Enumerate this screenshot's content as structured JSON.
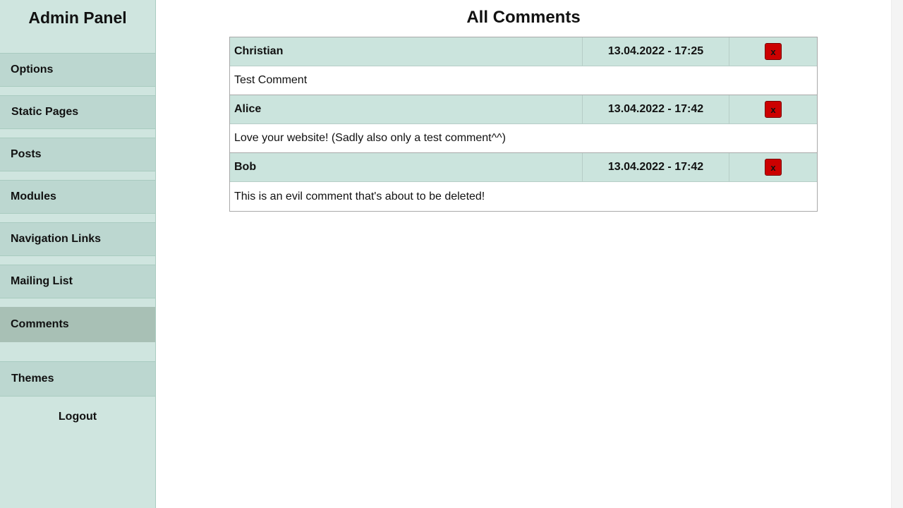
{
  "sidebar": {
    "title": "Admin Panel",
    "items": [
      {
        "label": "Options"
      },
      {
        "label": "Static Pages"
      },
      {
        "label": "Posts"
      },
      {
        "label": "Modules"
      },
      {
        "label": "Navigation Links"
      },
      {
        "label": "Mailing List"
      },
      {
        "label": "Comments",
        "active": true
      },
      {
        "label": "Themes"
      }
    ],
    "logout_label": "Logout"
  },
  "main": {
    "title": "All Comments",
    "comments": [
      {
        "author": "Christian",
        "date": "13.04.2022 - 17:25",
        "text": "Test Comment",
        "delete_label": "x"
      },
      {
        "author": "Alice",
        "date": "13.04.2022 - 17:42",
        "text": "Love your website! (Sadly also only a test comment^^)",
        "delete_label": "x"
      },
      {
        "author": "Bob",
        "date": "13.04.2022 - 17:42",
        "text": "This is an evil comment that's about to be deleted!",
        "delete_label": "x"
      }
    ]
  },
  "colors": {
    "sidebar_bg": "#cfe5df",
    "nav_item_bg": "#bcd7d0",
    "nav_item_active_bg": "#a8c0b5",
    "comment_header_bg": "#cbe4dd",
    "delete_button": "#cc0000"
  }
}
